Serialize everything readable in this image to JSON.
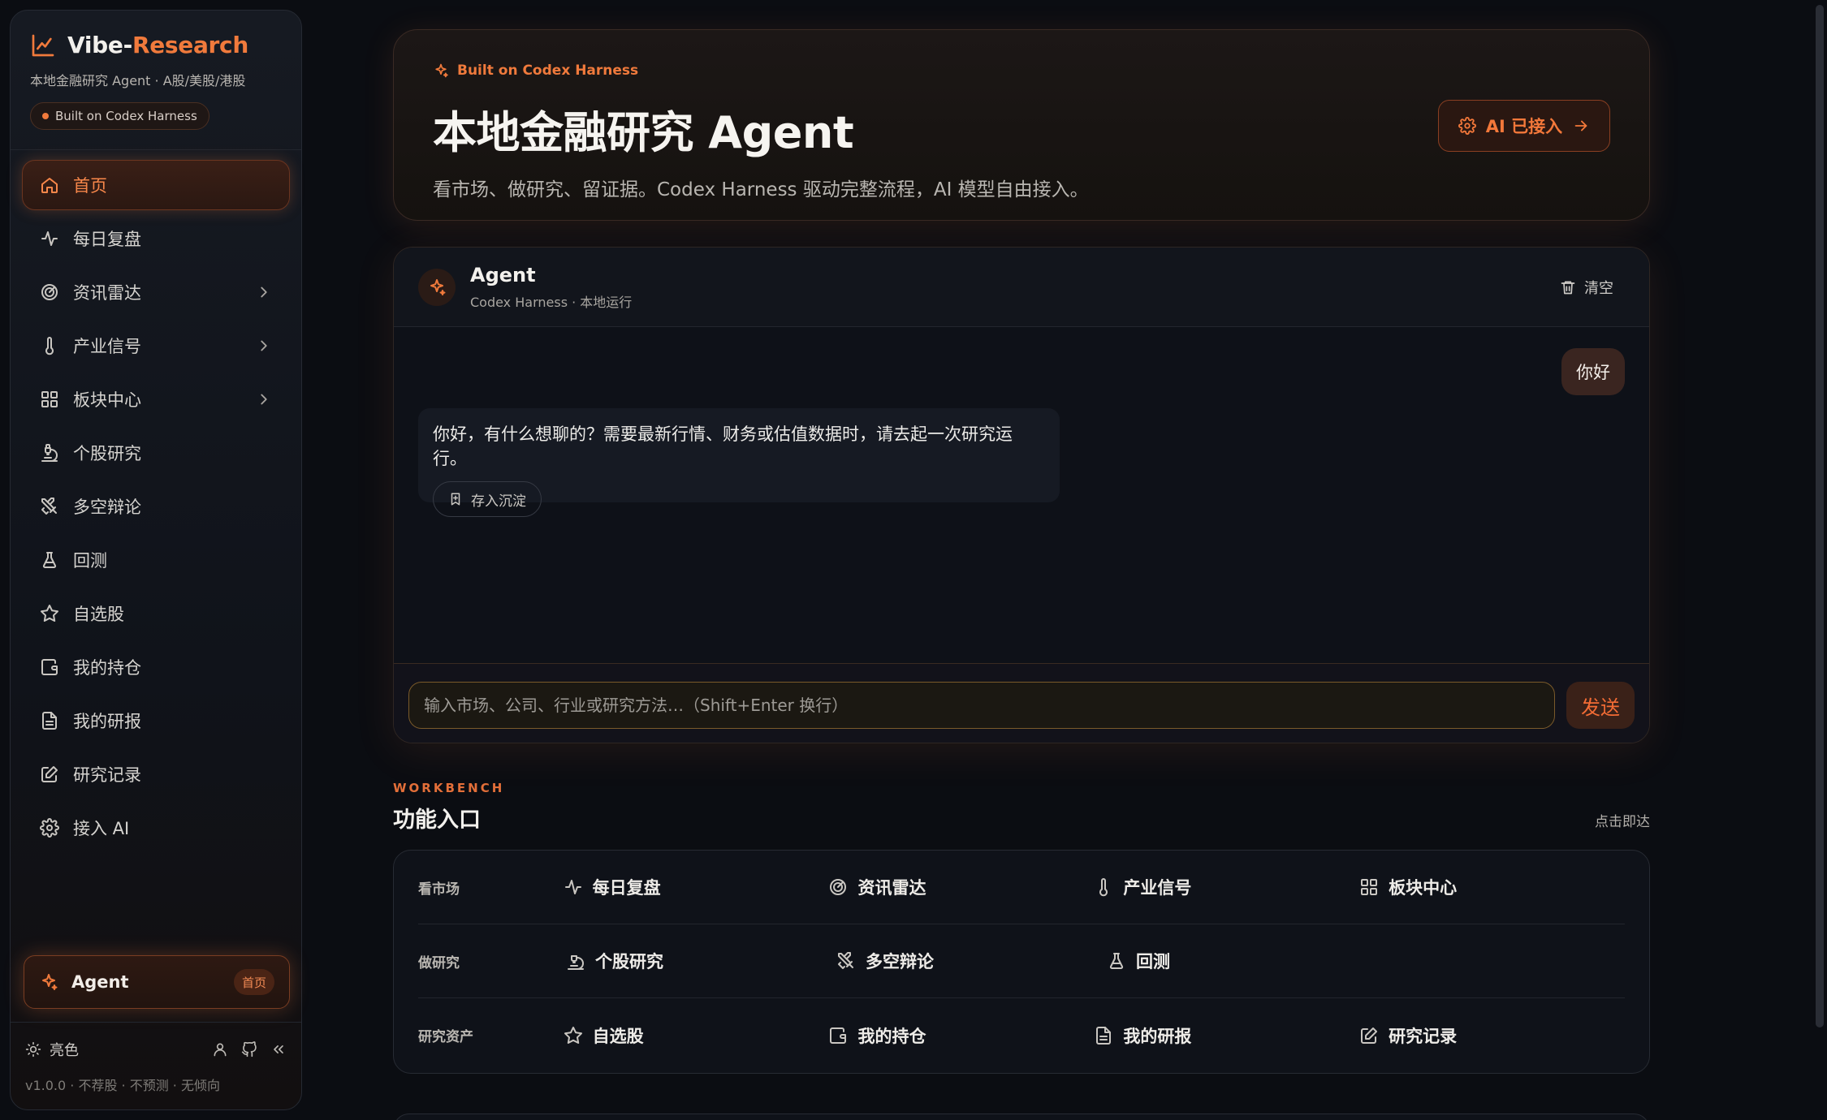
{
  "sidebar": {
    "brand_prefix": "Vibe-",
    "brand_accent": "Research",
    "brand_subtitle": "本地金融研究 Agent · A股/美股/港股",
    "badge": "Built on Codex Harness",
    "items": [
      {
        "label": "首页",
        "icon": "home-icon"
      },
      {
        "label": "每日复盘",
        "icon": "activity-icon"
      },
      {
        "label": "资讯雷达",
        "icon": "radar-icon"
      },
      {
        "label": "产业信号",
        "icon": "thermometer-icon"
      },
      {
        "label": "板块中心",
        "icon": "grid-icon"
      },
      {
        "label": "个股研究",
        "icon": "microscope-icon"
      },
      {
        "label": "多空辩论",
        "icon": "swords-icon"
      },
      {
        "label": "回测",
        "icon": "flask-icon"
      },
      {
        "label": "自选股",
        "icon": "star-icon"
      },
      {
        "label": "我的持仓",
        "icon": "wallet-icon"
      },
      {
        "label": "我的研报",
        "icon": "file-icon"
      },
      {
        "label": "研究记录",
        "icon": "edit-icon"
      },
      {
        "label": "接入 AI",
        "icon": "settings-icon"
      }
    ],
    "agent_button": {
      "label": "Agent",
      "tag": "首页"
    },
    "footer": {
      "theme_label": "亮色",
      "version": "v1.0.0 · 不荐股 · 不预测 · 无倾向"
    }
  },
  "hero": {
    "badge": "Built on Codex Harness",
    "title": "本地金融研究 Agent",
    "subtitle": "看市场、做研究、留证据。Codex Harness 驱动完整流程，AI 模型自由接入。",
    "button": "AI 已接入"
  },
  "chat": {
    "title": "Agent",
    "subtitle": "Codex Harness · 本地运行",
    "clear": "清空",
    "user_message": "你好",
    "bot_message": "你好，有什么想聊的？需要最新行情、财务或估值数据时，请去起一次研究运行。",
    "save_label": "存入沉淀",
    "input_placeholder": "输入市场、公司、行业或研究方法…（Shift+Enter 换行）",
    "send": "发送"
  },
  "workbench": {
    "label": "WORKBENCH",
    "title": "功能入口",
    "hint": "点击即达",
    "rows": [
      {
        "category": "看市场",
        "items": [
          "每日复盘",
          "资讯雷达",
          "产业信号",
          "板块中心"
        ]
      },
      {
        "category": "做研究",
        "items": [
          "个股研究",
          "多空辩论",
          "回测"
        ]
      },
      {
        "category": "研究资产",
        "items": [
          "自选股",
          "我的持仓",
          "我的研报",
          "研究记录"
        ]
      }
    ]
  },
  "colors": {
    "accent": "#f07a3c",
    "background": "#0b0d12"
  }
}
